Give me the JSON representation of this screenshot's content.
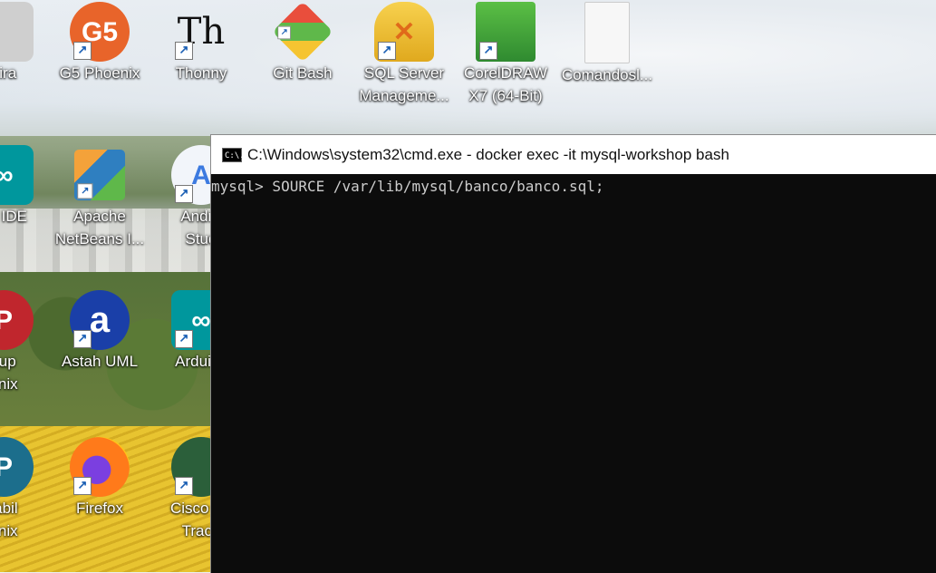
{
  "desktop": {
    "icons": [
      {
        "id": "lixeira",
        "label_lines": [
          "eira"
        ],
        "glyph": "trash-icon",
        "color": "#c9c9c9"
      },
      {
        "id": "g5",
        "label_lines": [
          "G5 Phoenix"
        ],
        "glyph": "G5",
        "color": "#e8642a"
      },
      {
        "id": "thonny",
        "label_lines": [
          "Thonny"
        ],
        "glyph": "Th",
        "color": "#ffffff"
      },
      {
        "id": "gitbash",
        "label_lines": [
          "Git Bash"
        ],
        "glyph": "git",
        "color": "#e94e3c"
      },
      {
        "id": "sqlserver",
        "label_lines": [
          "SQL Server",
          "Manageme..."
        ],
        "glyph": "db-tools",
        "color": "#f2c12e"
      },
      {
        "id": "corel",
        "label_lines": [
          "CorelDRAW",
          "X7 (64-Bit)"
        ],
        "glyph": "balloon",
        "color": "#3a9b3a"
      },
      {
        "id": "comandos",
        "label_lines": [
          "Comandosl..."
        ],
        "glyph": "doc",
        "color": "#ffffff"
      },
      {
        "id": "arduinoide",
        "label_lines": [
          "no IDE"
        ],
        "glyph": "∞",
        "color": "#00979d"
      },
      {
        "id": "netbeans",
        "label_lines": [
          "Apache",
          "NetBeans I..."
        ],
        "glyph": "cube",
        "color": "#2f7fc0"
      },
      {
        "id": "android",
        "label_lines": [
          "Andro",
          "Stud"
        ],
        "glyph": "A",
        "color": "#3c7ae0"
      },
      {
        "id": "backup",
        "label_lines": [
          "kup",
          "enix"
        ],
        "glyph": "P",
        "color": "#c0262d"
      },
      {
        "id": "astah",
        "label_lines": [
          "Astah UML"
        ],
        "glyph": "a",
        "color": "#1a3fa8"
      },
      {
        "id": "arduino",
        "label_lines": [
          "Arduinc"
        ],
        "glyph": "∞",
        "color": "#00979d"
      },
      {
        "id": "contabil",
        "label_lines": [
          "tábil",
          "enix"
        ],
        "glyph": "P",
        "color": "#1c6e8c"
      },
      {
        "id": "firefox",
        "label_lines": [
          "Firefox"
        ],
        "glyph": "ff",
        "color": "#ff7a1a"
      },
      {
        "id": "cisco",
        "label_lines": [
          "Cisco Pa",
          "Trace"
        ],
        "glyph": "pt",
        "color": "#2b5f3a"
      }
    ]
  },
  "cmd": {
    "title": "C:\\Windows\\system32\\cmd.exe - docker  exec -it mysql-workshop bash",
    "icon_text": "C:\\.",
    "line1": "mysql> SOURCE /var/lib/mysql/banco/banco.sql;"
  }
}
